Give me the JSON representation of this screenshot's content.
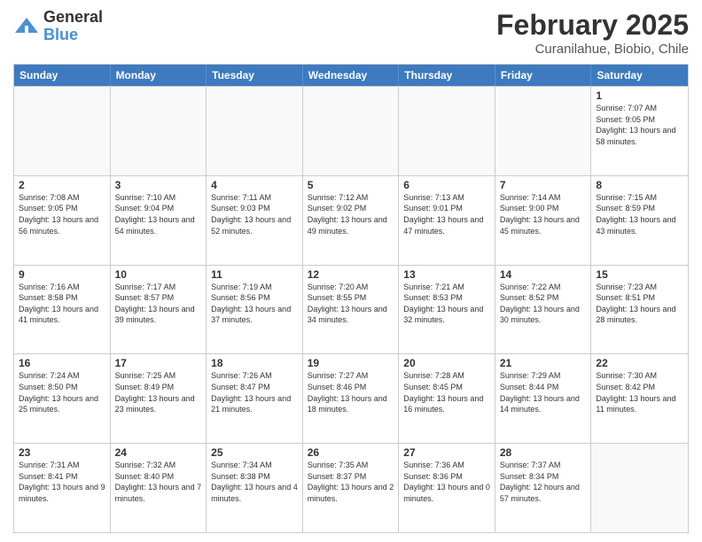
{
  "logo": {
    "general": "General",
    "blue": "Blue"
  },
  "title": "February 2025",
  "subtitle": "Curanilahue, Biobio, Chile",
  "weekdays": [
    "Sunday",
    "Monday",
    "Tuesday",
    "Wednesday",
    "Thursday",
    "Friday",
    "Saturday"
  ],
  "weeks": [
    [
      {
        "day": "",
        "info": ""
      },
      {
        "day": "",
        "info": ""
      },
      {
        "day": "",
        "info": ""
      },
      {
        "day": "",
        "info": ""
      },
      {
        "day": "",
        "info": ""
      },
      {
        "day": "",
        "info": ""
      },
      {
        "day": "1",
        "info": "Sunrise: 7:07 AM\nSunset: 9:05 PM\nDaylight: 13 hours\nand 58 minutes."
      }
    ],
    [
      {
        "day": "2",
        "info": "Sunrise: 7:08 AM\nSunset: 9:05 PM\nDaylight: 13 hours\nand 56 minutes."
      },
      {
        "day": "3",
        "info": "Sunrise: 7:10 AM\nSunset: 9:04 PM\nDaylight: 13 hours\nand 54 minutes."
      },
      {
        "day": "4",
        "info": "Sunrise: 7:11 AM\nSunset: 9:03 PM\nDaylight: 13 hours\nand 52 minutes."
      },
      {
        "day": "5",
        "info": "Sunrise: 7:12 AM\nSunset: 9:02 PM\nDaylight: 13 hours\nand 49 minutes."
      },
      {
        "day": "6",
        "info": "Sunrise: 7:13 AM\nSunset: 9:01 PM\nDaylight: 13 hours\nand 47 minutes."
      },
      {
        "day": "7",
        "info": "Sunrise: 7:14 AM\nSunset: 9:00 PM\nDaylight: 13 hours\nand 45 minutes."
      },
      {
        "day": "8",
        "info": "Sunrise: 7:15 AM\nSunset: 8:59 PM\nDaylight: 13 hours\nand 43 minutes."
      }
    ],
    [
      {
        "day": "9",
        "info": "Sunrise: 7:16 AM\nSunset: 8:58 PM\nDaylight: 13 hours\nand 41 minutes."
      },
      {
        "day": "10",
        "info": "Sunrise: 7:17 AM\nSunset: 8:57 PM\nDaylight: 13 hours\nand 39 minutes."
      },
      {
        "day": "11",
        "info": "Sunrise: 7:19 AM\nSunset: 8:56 PM\nDaylight: 13 hours\nand 37 minutes."
      },
      {
        "day": "12",
        "info": "Sunrise: 7:20 AM\nSunset: 8:55 PM\nDaylight: 13 hours\nand 34 minutes."
      },
      {
        "day": "13",
        "info": "Sunrise: 7:21 AM\nSunset: 8:53 PM\nDaylight: 13 hours\nand 32 minutes."
      },
      {
        "day": "14",
        "info": "Sunrise: 7:22 AM\nSunset: 8:52 PM\nDaylight: 13 hours\nand 30 minutes."
      },
      {
        "day": "15",
        "info": "Sunrise: 7:23 AM\nSunset: 8:51 PM\nDaylight: 13 hours\nand 28 minutes."
      }
    ],
    [
      {
        "day": "16",
        "info": "Sunrise: 7:24 AM\nSunset: 8:50 PM\nDaylight: 13 hours\nand 25 minutes."
      },
      {
        "day": "17",
        "info": "Sunrise: 7:25 AM\nSunset: 8:49 PM\nDaylight: 13 hours\nand 23 minutes."
      },
      {
        "day": "18",
        "info": "Sunrise: 7:26 AM\nSunset: 8:47 PM\nDaylight: 13 hours\nand 21 minutes."
      },
      {
        "day": "19",
        "info": "Sunrise: 7:27 AM\nSunset: 8:46 PM\nDaylight: 13 hours\nand 18 minutes."
      },
      {
        "day": "20",
        "info": "Sunrise: 7:28 AM\nSunset: 8:45 PM\nDaylight: 13 hours\nand 16 minutes."
      },
      {
        "day": "21",
        "info": "Sunrise: 7:29 AM\nSunset: 8:44 PM\nDaylight: 13 hours\nand 14 minutes."
      },
      {
        "day": "22",
        "info": "Sunrise: 7:30 AM\nSunset: 8:42 PM\nDaylight: 13 hours\nand 11 minutes."
      }
    ],
    [
      {
        "day": "23",
        "info": "Sunrise: 7:31 AM\nSunset: 8:41 PM\nDaylight: 13 hours\nand 9 minutes."
      },
      {
        "day": "24",
        "info": "Sunrise: 7:32 AM\nSunset: 8:40 PM\nDaylight: 13 hours\nand 7 minutes."
      },
      {
        "day": "25",
        "info": "Sunrise: 7:34 AM\nSunset: 8:38 PM\nDaylight: 13 hours\nand 4 minutes."
      },
      {
        "day": "26",
        "info": "Sunrise: 7:35 AM\nSunset: 8:37 PM\nDaylight: 13 hours\nand 2 minutes."
      },
      {
        "day": "27",
        "info": "Sunrise: 7:36 AM\nSunset: 8:36 PM\nDaylight: 13 hours\nand 0 minutes."
      },
      {
        "day": "28",
        "info": "Sunrise: 7:37 AM\nSunset: 8:34 PM\nDaylight: 12 hours\nand 57 minutes."
      },
      {
        "day": "",
        "info": ""
      }
    ]
  ]
}
